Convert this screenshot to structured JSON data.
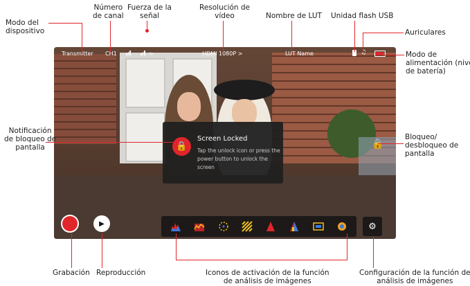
{
  "callouts": {
    "device_mode": "Modo del\ndispositivo",
    "channel_number": "Número\nde canal",
    "signal_strength": "Fuerza de la\nseñal",
    "video_resolution": "Resolución de\nvídeo",
    "lut_name": "Nombre de LUT",
    "usb_flash": "Unidad flash USB",
    "headphones": "Auriculares",
    "power_mode": "Modo de\nalimentación (nivel\nde batería)",
    "screen_lock_notification": "Notificación\nde bloqueo de\npantalla",
    "lock_unlock": "Bloqueo/\ndesbloqueo de\npantalla",
    "recording": "Grabación",
    "playback": "Reproducción",
    "analysis_icons": "Iconos de activación de la función\nde análisis de imágenes",
    "analysis_settings": "Configuración de la función de\nanálisis de imágenes"
  },
  "status_bar": {
    "mode": "Transmitter",
    "channel": "CH1",
    "signal_arrow": ">",
    "resolution": "HDMI 1080P >",
    "lut": "LUT Name"
  },
  "popup": {
    "title": "Screen Locked",
    "body": "Tap the unlock icon or press the power button to unlock the screen"
  },
  "icons": {
    "lock": "🔒",
    "play": "▶",
    "settings": "⚙",
    "tools": [
      "histogram-icon",
      "waveform-icon",
      "vectorscope-icon",
      "zebra-icon",
      "peaking-icon",
      "false-color-icon",
      "frame-guide-icon",
      "focus-assist-icon"
    ]
  },
  "colors": {
    "accent": "#e0262b"
  }
}
